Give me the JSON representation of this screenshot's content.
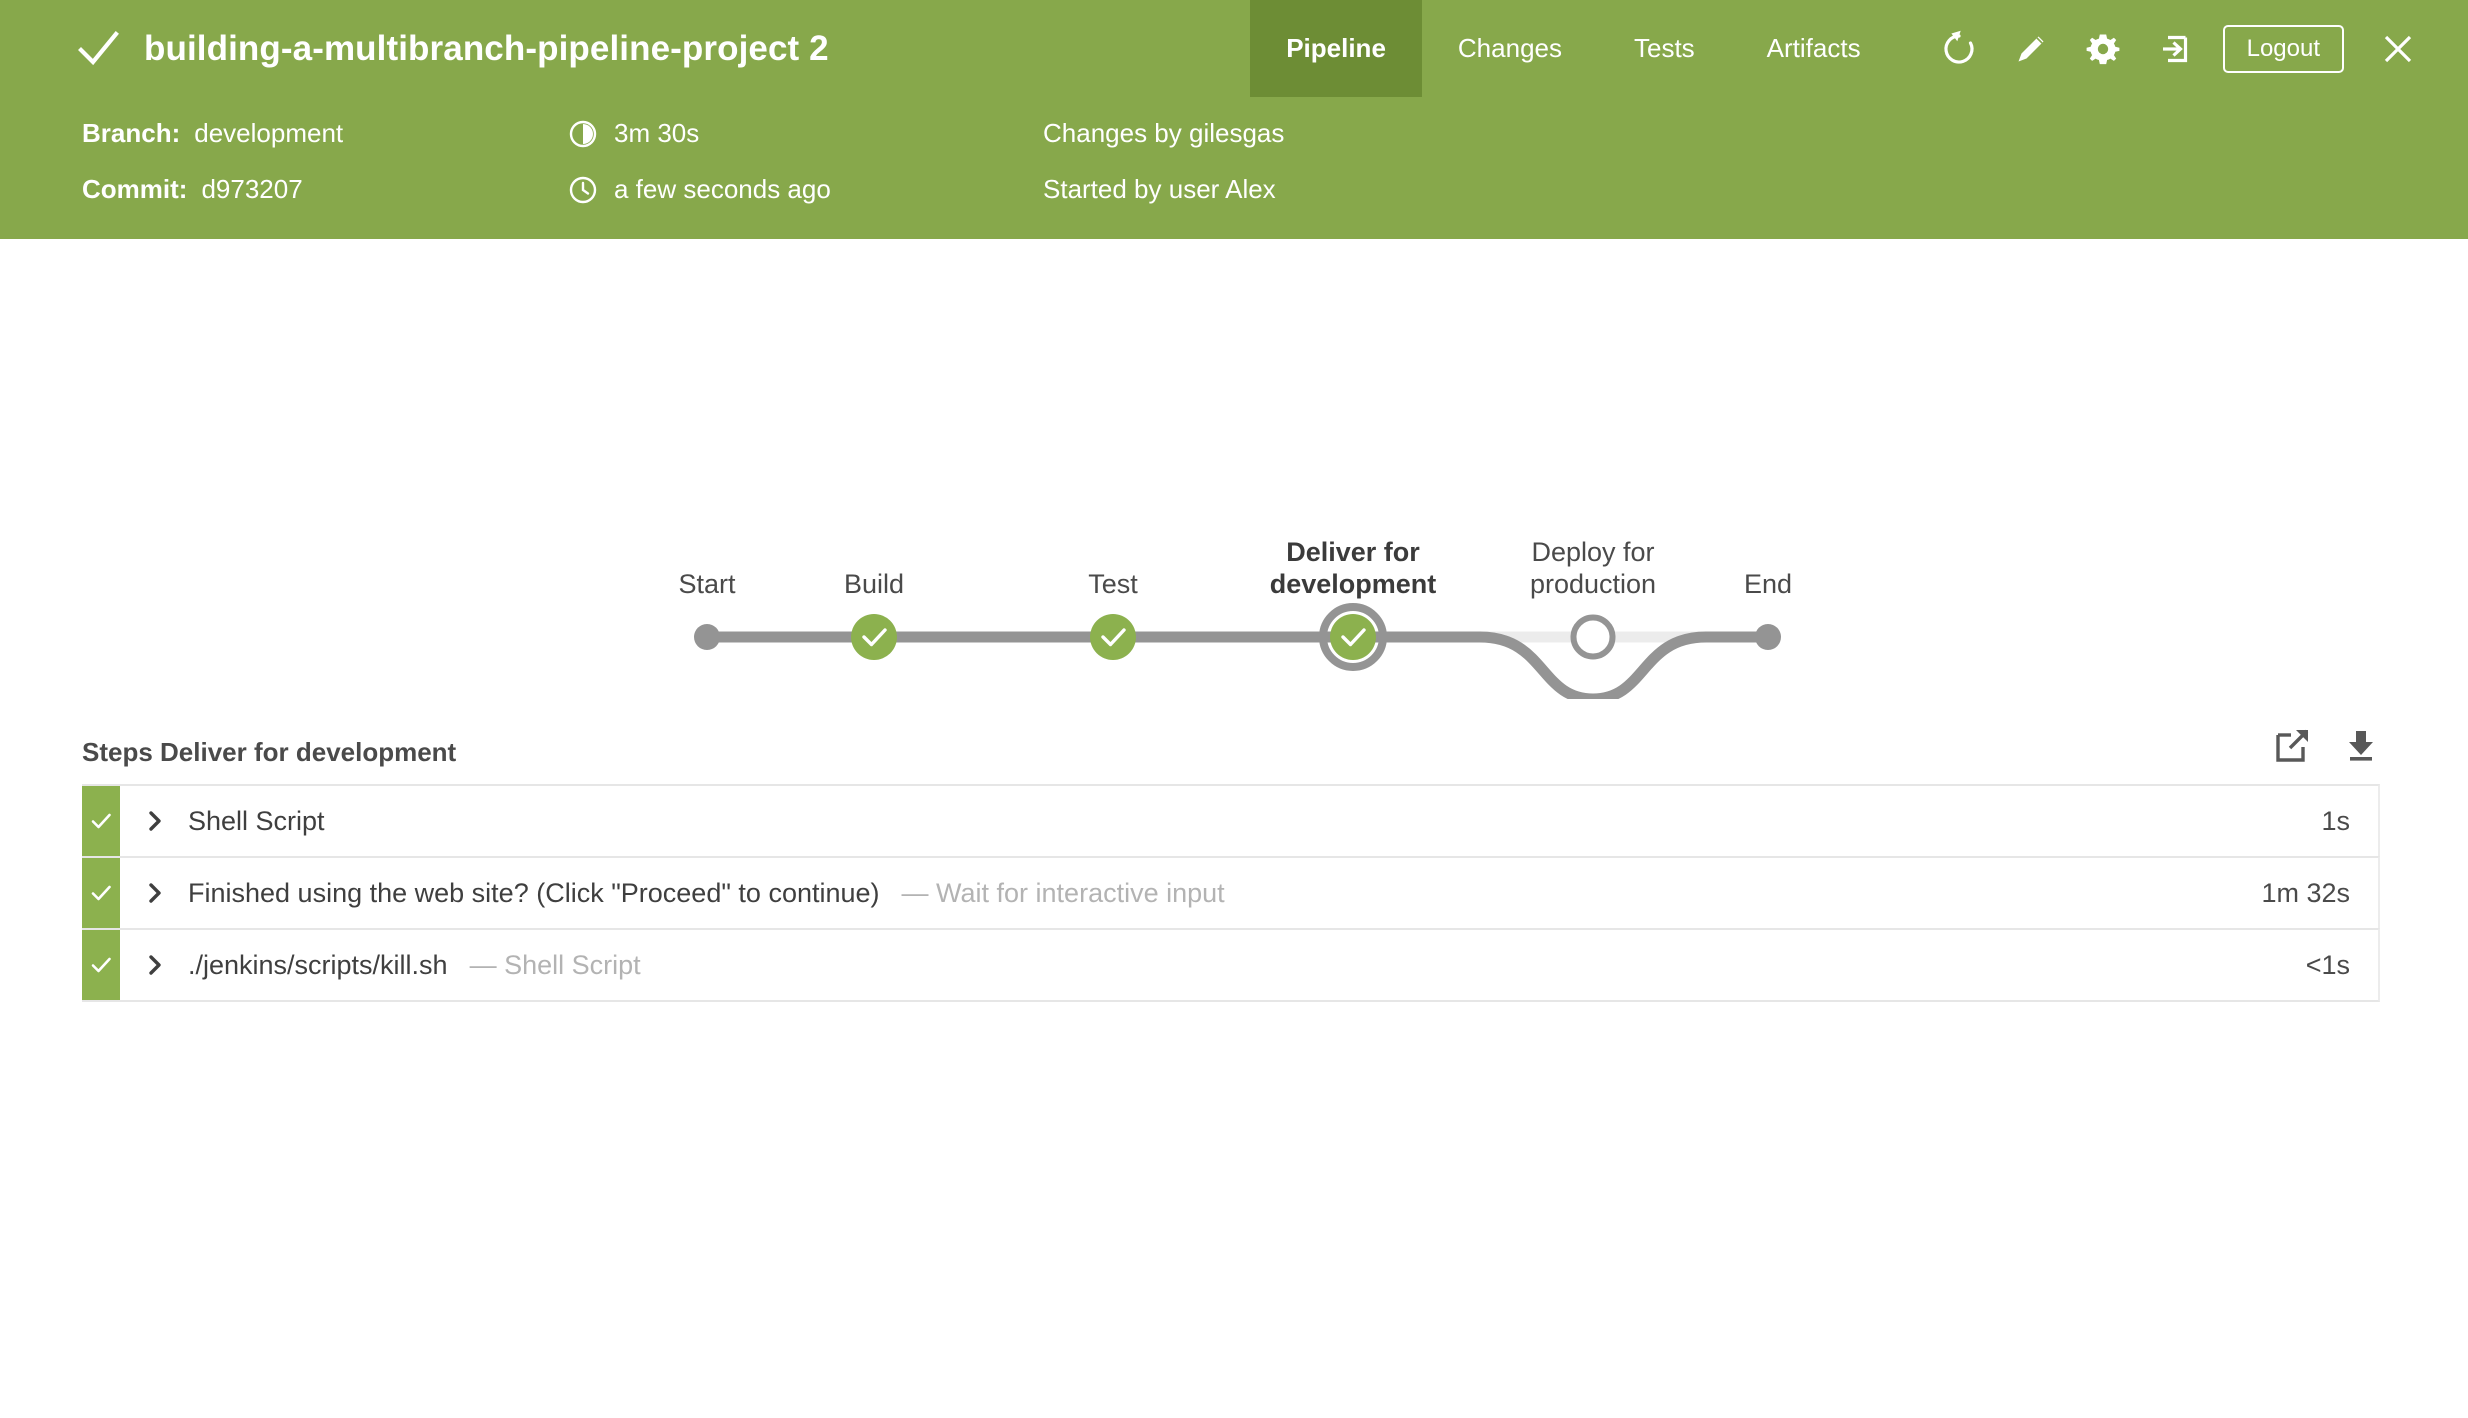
{
  "header": {
    "status_icon": "check-icon",
    "title": "building-a-multibranch-pipeline-project 2",
    "tabs": [
      {
        "label": "Pipeline",
        "active": true
      },
      {
        "label": "Changes",
        "active": false
      },
      {
        "label": "Tests",
        "active": false
      },
      {
        "label": "Artifacts",
        "active": false
      }
    ],
    "actions": [
      {
        "icon": "replay-icon"
      },
      {
        "icon": "edit-pencil-icon"
      },
      {
        "icon": "gear-icon"
      },
      {
        "icon": "logout-arrow-icon"
      }
    ],
    "logout_label": "Logout",
    "close_icon": "close-icon",
    "bg_color": "#87a84b",
    "active_tab_color": "#6d8d35"
  },
  "meta": {
    "branch_label": "Branch:",
    "branch_value": "development",
    "commit_label": "Commit:",
    "commit_value": "d973207",
    "duration_icon": "duration-icon",
    "duration_value": "3m 30s",
    "time_icon": "clock-icon",
    "time_value": "a few seconds ago",
    "changes_by": "Changes by gilesgas",
    "started_by": "Started by user Alex"
  },
  "pipeline": {
    "stages": [
      {
        "label": "Start",
        "type": "terminal",
        "state": "complete",
        "selected": false
      },
      {
        "label": "Build",
        "type": "stage",
        "state": "success",
        "selected": false
      },
      {
        "label": "Test",
        "type": "stage",
        "state": "success",
        "selected": false
      },
      {
        "label": "Deliver for development",
        "type": "stage",
        "state": "success",
        "selected": true
      },
      {
        "label": "Deploy for production",
        "type": "stage",
        "state": "not-built",
        "selected": false
      },
      {
        "label": "End",
        "type": "terminal",
        "state": "complete",
        "selected": false
      }
    ],
    "success_color": "#8cb14e",
    "line_color": "#949494",
    "inactive_line_color": "#ececec"
  },
  "steps": {
    "title": "Steps Deliver for development",
    "open_icon": "external-link-icon",
    "download_icon": "download-icon",
    "rows": [
      {
        "status": "success",
        "label": "Shell Script",
        "sublabel": "",
        "duration": "1s"
      },
      {
        "status": "success",
        "label": "Finished using the web site? (Click \"Proceed\" to continue)",
        "sublabel": "— Wait for interactive input",
        "duration": "1m 32s"
      },
      {
        "status": "success",
        "label": "./jenkins/scripts/kill.sh",
        "sublabel": "— Shell Script",
        "duration": "<1s"
      }
    ]
  }
}
